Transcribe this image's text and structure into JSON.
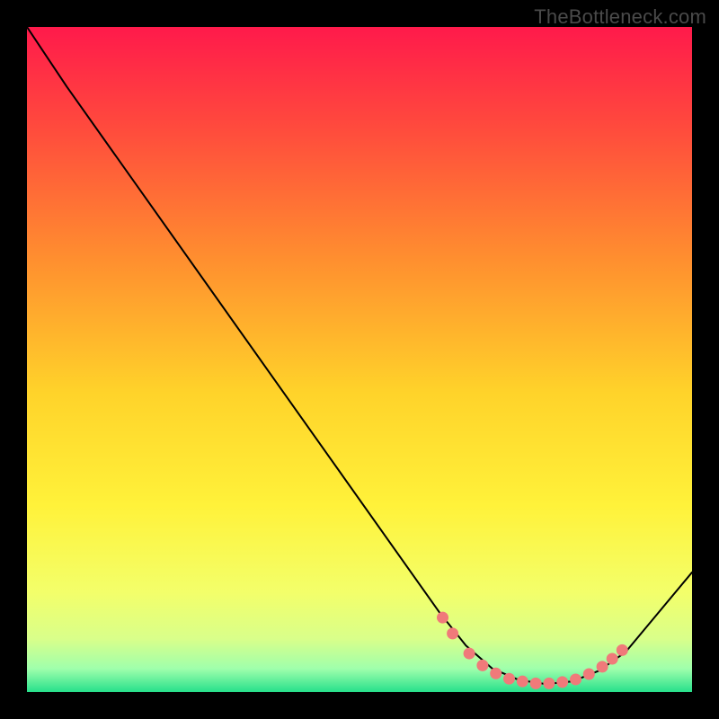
{
  "watermark": "TheBottleneck.com",
  "chart_data": {
    "type": "line",
    "title": "",
    "xlabel": "",
    "ylabel": "",
    "xlim": [
      0,
      100
    ],
    "ylim": [
      0,
      100
    ],
    "grid": false,
    "gradient_stops": [
      {
        "offset": 0.0,
        "color": "#ff1a4b"
      },
      {
        "offset": 0.15,
        "color": "#ff4a3d"
      },
      {
        "offset": 0.35,
        "color": "#ff8f2f"
      },
      {
        "offset": 0.55,
        "color": "#ffd32a"
      },
      {
        "offset": 0.72,
        "color": "#fff23a"
      },
      {
        "offset": 0.85,
        "color": "#f3ff6a"
      },
      {
        "offset": 0.92,
        "color": "#d9ff8a"
      },
      {
        "offset": 0.965,
        "color": "#9fffac"
      },
      {
        "offset": 1.0,
        "color": "#27e08b"
      }
    ],
    "curve": [
      {
        "x": 0.0,
        "y": 100.0
      },
      {
        "x": 3.0,
        "y": 95.5
      },
      {
        "x": 6.0,
        "y": 91.0
      },
      {
        "x": 62.0,
        "y": 12.0
      },
      {
        "x": 66.0,
        "y": 7.0
      },
      {
        "x": 70.0,
        "y": 3.5
      },
      {
        "x": 74.0,
        "y": 1.8
      },
      {
        "x": 78.0,
        "y": 1.2
      },
      {
        "x": 82.0,
        "y": 1.6
      },
      {
        "x": 86.0,
        "y": 3.2
      },
      {
        "x": 90.0,
        "y": 6.0
      },
      {
        "x": 100.0,
        "y": 18.0
      }
    ],
    "markers": [
      {
        "x": 62.5,
        "y": 11.2
      },
      {
        "x": 64.0,
        "y": 8.8
      },
      {
        "x": 66.5,
        "y": 5.8
      },
      {
        "x": 68.5,
        "y": 4.0
      },
      {
        "x": 70.5,
        "y": 2.8
      },
      {
        "x": 72.5,
        "y": 2.0
      },
      {
        "x": 74.5,
        "y": 1.6
      },
      {
        "x": 76.5,
        "y": 1.3
      },
      {
        "x": 78.5,
        "y": 1.3
      },
      {
        "x": 80.5,
        "y": 1.5
      },
      {
        "x": 82.5,
        "y": 1.9
      },
      {
        "x": 84.5,
        "y": 2.7
      },
      {
        "x": 86.5,
        "y": 3.8
      },
      {
        "x": 88.0,
        "y": 5.0
      },
      {
        "x": 89.5,
        "y": 6.3
      }
    ],
    "marker_color": "#f07a7a",
    "line_color": "#000000",
    "marker_radius": 6.5,
    "line_width": 2
  }
}
